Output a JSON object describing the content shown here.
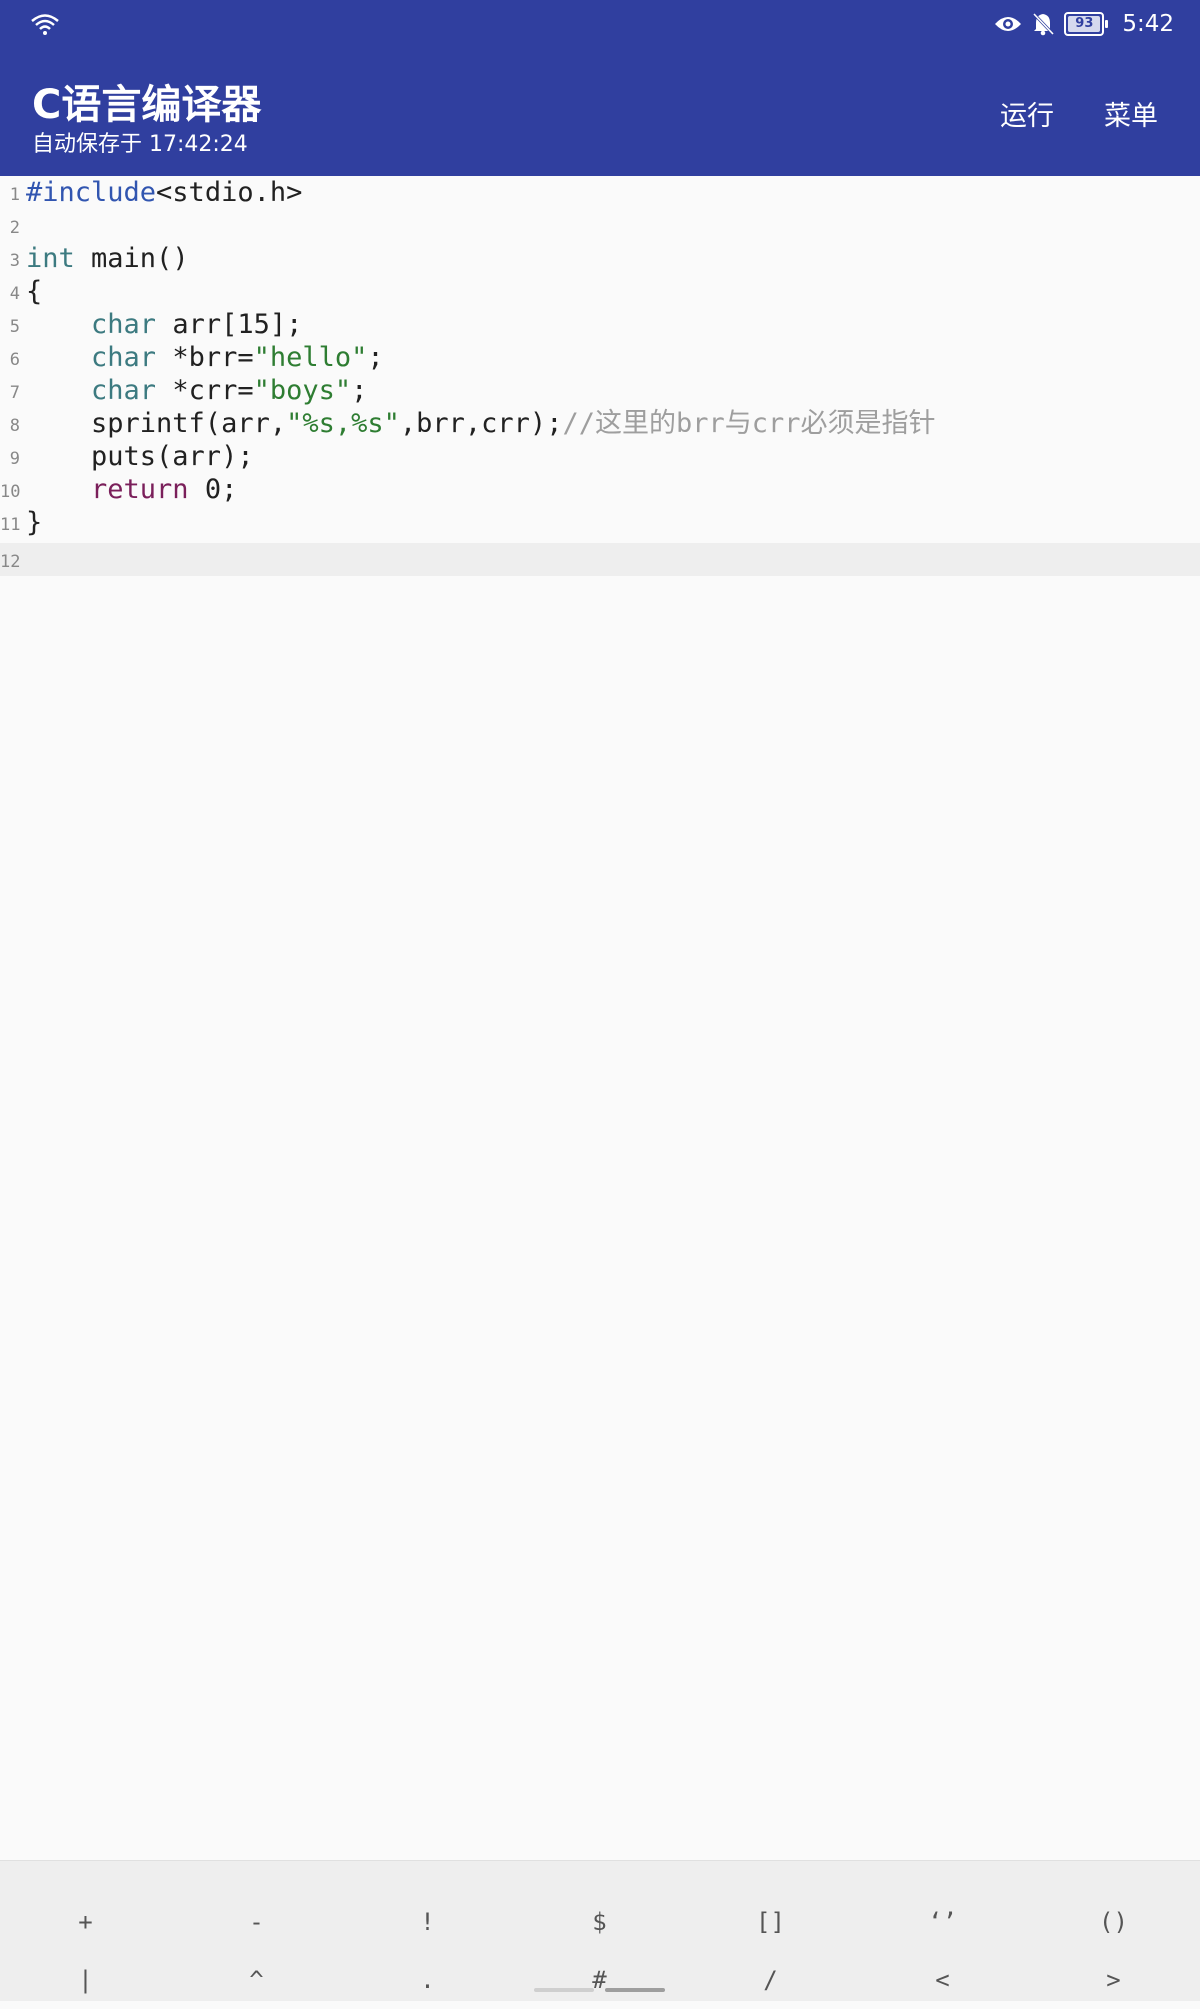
{
  "status_bar": {
    "wifi_icon": "wifi-icon",
    "eye_icon": "eye-icon",
    "bell_off_icon": "notifications-off-icon",
    "battery_level": "93",
    "time": "5:42"
  },
  "app_bar": {
    "title": "C语言编译器",
    "subtitle": "自动保存于 17:42:24",
    "run_label": "运行",
    "menu_label": "菜单"
  },
  "editor": {
    "current_line": 12,
    "lines": [
      {
        "num": "1"
      },
      {
        "num": "2"
      },
      {
        "num": "3"
      },
      {
        "num": "4"
      },
      {
        "num": "5"
      },
      {
        "num": "6"
      },
      {
        "num": "7"
      },
      {
        "num": "8"
      },
      {
        "num": "9"
      },
      {
        "num": "10"
      },
      {
        "num": "11"
      },
      {
        "num": "12"
      }
    ],
    "code": {
      "l1_pp": "#include",
      "l1_rest": "<stdio.h>",
      "l3_kw": "int",
      "l3_rest": " main()",
      "l4": "{",
      "l5_indent": "    ",
      "l5_kw": "char",
      "l5_rest": " arr[15];",
      "l6_kw": "char",
      "l6_mid": " *brr=",
      "l6_str": "\"hello\"",
      "l6_end": ";",
      "l7_kw": "char",
      "l7_mid": " *crr=",
      "l7_str": "\"boys\"",
      "l7_end": ";",
      "l8_a": "    sprintf(arr,",
      "l8_str": "\"%s,%s\"",
      "l8_b": ",brr,crr);",
      "l8_cmt": "//这里的brr与crr必须是指针",
      "l9": "    puts(arr);",
      "l10_ret": "return",
      "l10_rest": " 0;",
      "l11": "}"
    }
  },
  "symbol_keys": {
    "row1": [
      "+",
      "-",
      "!",
      "$",
      "[]",
      "‘’",
      "()"
    ],
    "row2": [
      "|",
      "^",
      ".",
      "#",
      "/",
      "<",
      ">"
    ]
  }
}
